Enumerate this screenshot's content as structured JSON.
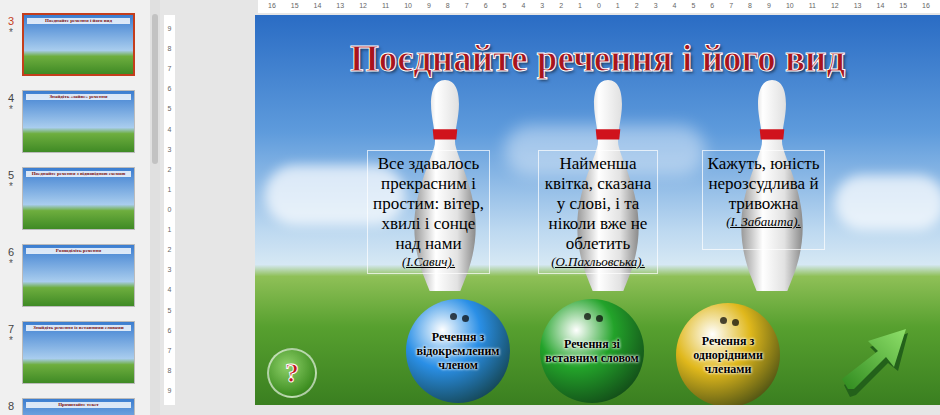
{
  "slide_panel": {
    "slides": [
      {
        "number": "3",
        "star": "*",
        "title": "Поєднайте речення і його вид",
        "selected": true
      },
      {
        "number": "4",
        "star": "*",
        "title": "Знайдіть «зайве» речення",
        "selected": false
      },
      {
        "number": "5",
        "star": "*",
        "title": "Поєднайте речення з відповідною схемою",
        "selected": false
      },
      {
        "number": "6",
        "star": "*",
        "title": "Розподіліть речення",
        "selected": false
      },
      {
        "number": "7",
        "star": "*",
        "title": "Знайдіть речення із вставними словами",
        "selected": false
      },
      {
        "number": "8",
        "star": "",
        "title": "Прочитайте текст",
        "selected": false
      }
    ]
  },
  "ruler_top": [
    "16",
    "15",
    "14",
    "13",
    "12",
    "11",
    "10",
    "9",
    "8",
    "7",
    "6",
    "5",
    "4",
    "3",
    "2",
    "1",
    "0",
    "1",
    "2",
    "3",
    "4",
    "5",
    "6",
    "7",
    "8",
    "9",
    "10",
    "11",
    "12",
    "13",
    "14",
    "15",
    "16"
  ],
  "ruler_left": [
    "9",
    "8",
    "7",
    "6",
    "5",
    "4",
    "3",
    "2",
    "1",
    "0",
    "1",
    "2",
    "3",
    "4",
    "5",
    "6",
    "7",
    "8",
    "9"
  ],
  "slide": {
    "title": "Поєднайте речення і його вид",
    "sentences": [
      {
        "text": "Все здавалось прекрасним і простим: вітер, хвилі і сонце над нами",
        "author": "(І.Савич)."
      },
      {
        "text": "Найменша квітка, сказана у слові, і та ніколи вже не облетить",
        "author": "(О.Пахльовська)."
      },
      {
        "text": "Кажуть, юність нерозсудлива й тривожна",
        "author": "(І. Забашта)."
      }
    ],
    "answers": [
      {
        "label": "Речення з відокремленим членом",
        "color": "#2a8fe6"
      },
      {
        "label": "Речення зі вставним словом",
        "color": "#23a32a"
      },
      {
        "label": "Речення з однорідними членами",
        "color": "#e0b81c"
      }
    ],
    "help_button": "?"
  }
}
